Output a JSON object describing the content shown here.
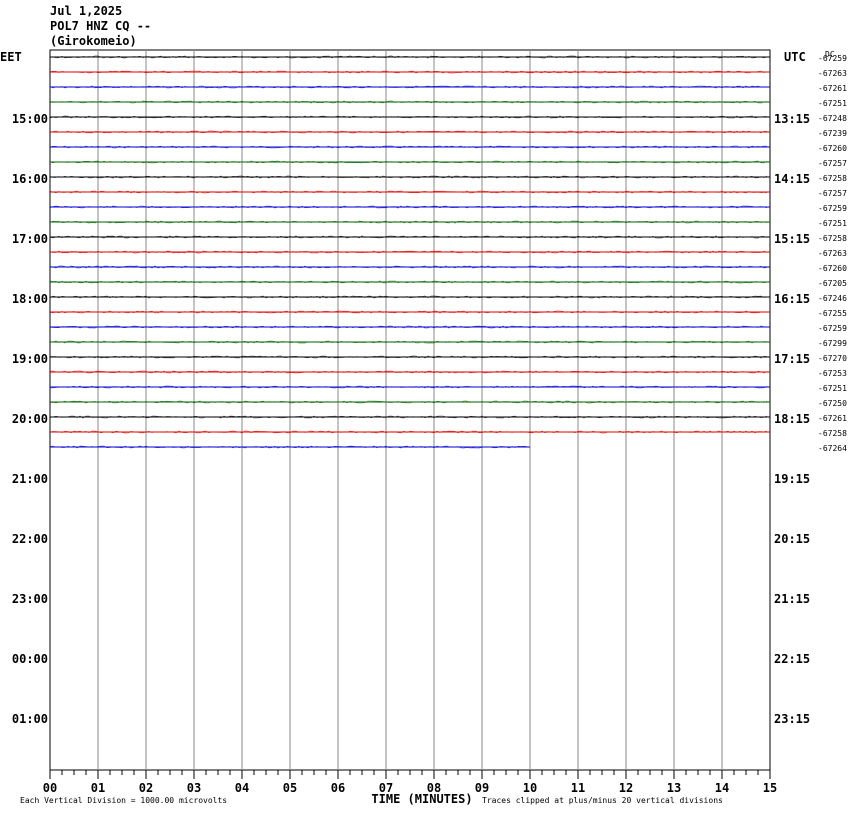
{
  "header": {
    "date": "Jul 1,2025",
    "station": "POL7 HNZ CQ --",
    "location": "(Girokomeio)"
  },
  "chart_data": {
    "type": "line",
    "title": "POL7 HNZ CQ --",
    "left_axis_label": "EET",
    "right_axis_label": "UTC",
    "corner_label": "DC",
    "xlabel": "TIME (MINUTES)",
    "x_ticks": [
      "00",
      "01",
      "02",
      "03",
      "04",
      "05",
      "06",
      "07",
      "08",
      "09",
      "10",
      "11",
      "12",
      "13",
      "14",
      "15"
    ],
    "xlim": [
      0,
      15
    ],
    "left_hour_labels": [
      "15:00",
      "16:00",
      "17:00",
      "18:00",
      "19:00",
      "20:00",
      "21:00",
      "22:00",
      "23:00",
      "00:00",
      "01:00"
    ],
    "right_hour_labels": [
      "13:15",
      "14:15",
      "15:15",
      "16:15",
      "17:15",
      "18:15",
      "19:15",
      "20:15",
      "21:15",
      "22:15",
      "23:15"
    ],
    "trace_colors": [
      "#000000",
      "#dd0000",
      "#0000cc",
      "#006600"
    ],
    "dc_offsets": [
      "-67259",
      "-67263",
      "-67261",
      "-67251",
      "-67248",
      "-67239",
      "-67260",
      "-67257",
      "-67258",
      "-67257",
      "-67259",
      "-67251",
      "-67258",
      "-67263",
      "-67260",
      "-67205",
      "-67246",
      "-67255",
      "-67259",
      "-67299",
      "-67270",
      "-67253",
      "-67251",
      "-67250",
      "-67261",
      "-67258",
      "-67264"
    ],
    "last_trace_end_minute": 10,
    "footer_left": "Each Vertical Division = 1000.00 microvolts",
    "footer_right": "Traces clipped at plus/minus 20 vertical divisions",
    "grid": true
  }
}
